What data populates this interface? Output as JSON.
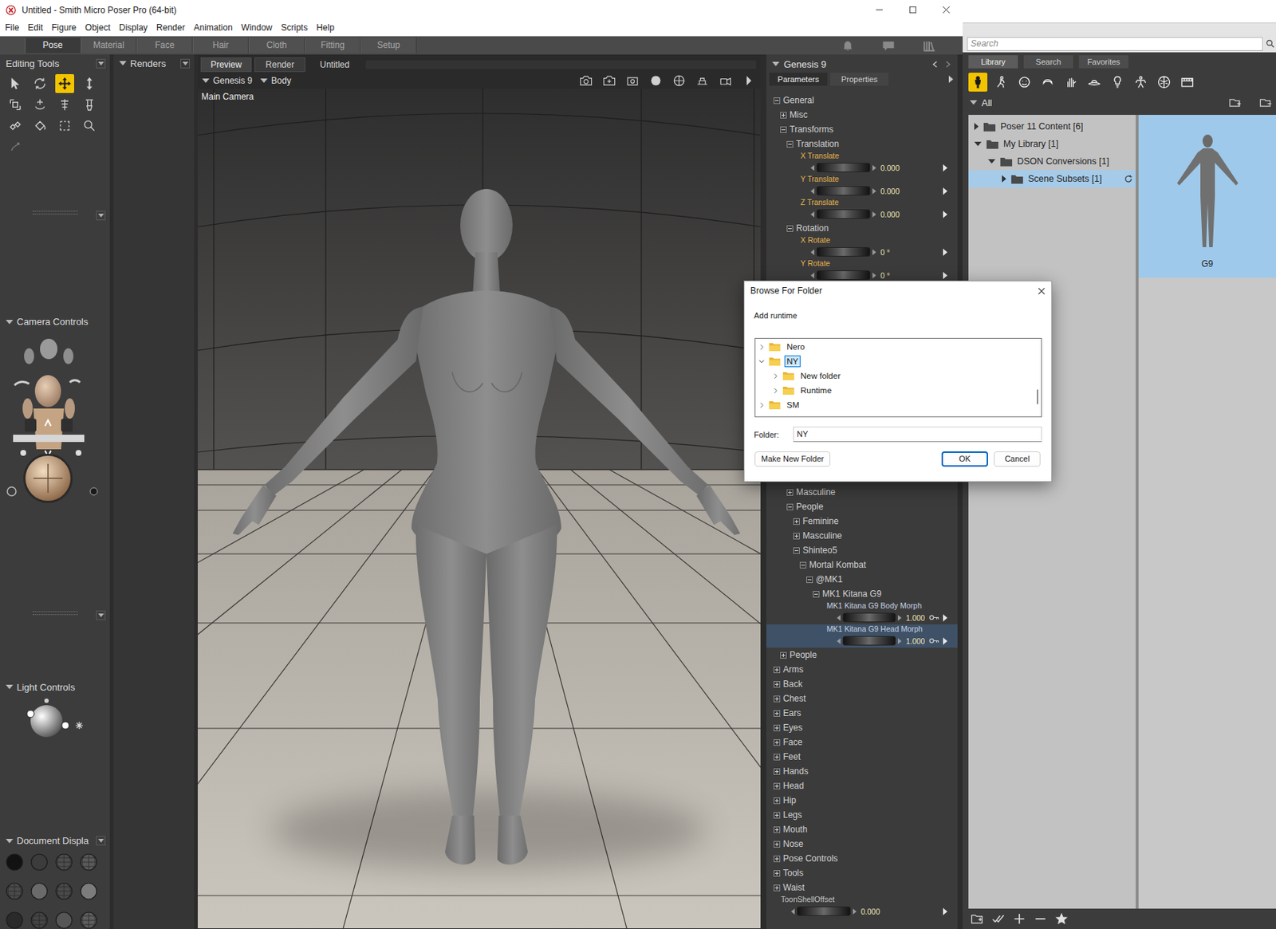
{
  "window": {
    "title": "Untitled - Smith Micro Poser Pro  (64-bit)"
  },
  "menu": [
    "File",
    "Edit",
    "Figure",
    "Object",
    "Display",
    "Render",
    "Animation",
    "Window",
    "Scripts",
    "Help"
  ],
  "rooms": [
    {
      "label": "Pose",
      "selected": true
    },
    {
      "label": "Material",
      "selected": false
    },
    {
      "label": "Face",
      "selected": false
    },
    {
      "label": "Hair",
      "selected": false
    },
    {
      "label": "Cloth",
      "selected": false
    },
    {
      "label": "Fitting",
      "selected": false
    },
    {
      "label": "Setup",
      "selected": false
    }
  ],
  "panels": {
    "editing_tools": "Editing Tools",
    "camera_controls": "Camera Controls",
    "light_controls": "Light Controls",
    "document_display": "Document Displa",
    "renders": "Renders"
  },
  "tools": [
    {
      "selected": false
    },
    {
      "selected": false
    },
    {
      "selected": true
    },
    {
      "selected": false
    },
    {
      "selected": false
    },
    {
      "selected": false
    },
    {
      "selected": false
    },
    {
      "selected": false
    },
    {
      "selected": false
    },
    {
      "selected": false
    },
    {
      "selected": false
    },
    {
      "selected": false
    },
    {
      "selected": false
    }
  ],
  "viewport": {
    "tabs": [
      {
        "label": "Preview",
        "selected": true
      },
      {
        "label": "Render",
        "selected": false
      }
    ],
    "document": "Untitled",
    "figure": "Genesis 9",
    "actor": "Body",
    "camera": "Main Camera"
  },
  "parameters": {
    "figure": "Genesis 9",
    "tabs": [
      {
        "label": "Parameters",
        "selected": true
      },
      {
        "label": "Properties",
        "selected": false
      }
    ],
    "rows_top": [
      {
        "kind": "group",
        "label": "General",
        "indent": 0,
        "expanded": true,
        "selected": false
      },
      {
        "kind": "group",
        "label": "Misc",
        "indent": 1,
        "expanded": false,
        "selected": false
      },
      {
        "kind": "group",
        "label": "Transforms",
        "indent": 1,
        "expanded": true,
        "selected": false
      },
      {
        "kind": "group",
        "label": "Translation",
        "indent": 2,
        "expanded": true,
        "selected": false
      },
      {
        "kind": "dial",
        "label": "X Translate",
        "indent": 3,
        "value": "0.000",
        "selected": false,
        "keyed": false,
        "color": "#e6b450"
      },
      {
        "kind": "dial",
        "label": "Y Translate",
        "indent": 3,
        "value": "0.000",
        "selected": false,
        "keyed": false,
        "color": "#e6b450"
      },
      {
        "kind": "dial",
        "label": "Z Translate",
        "indent": 3,
        "value": "0.000",
        "selected": false,
        "keyed": false,
        "color": "#e6b450"
      },
      {
        "kind": "group",
        "label": "Rotation",
        "indent": 2,
        "expanded": true,
        "selected": false
      },
      {
        "kind": "dial",
        "label": "X Rotate",
        "indent": 3,
        "value": "0 °",
        "selected": false,
        "keyed": false,
        "color": "#e6b450"
      },
      {
        "kind": "dial",
        "label": "Y Rotate",
        "indent": 3,
        "value": "0 °",
        "selected": false,
        "keyed": false,
        "color": "#e6b450"
      }
    ],
    "rows_bottom": [
      {
        "kind": "group",
        "label": "Masculine",
        "indent": 2,
        "expanded": false,
        "selected": false
      },
      {
        "kind": "group",
        "label": "People",
        "indent": 2,
        "expanded": true,
        "selected": false
      },
      {
        "kind": "group",
        "label": "Feminine",
        "indent": 3,
        "expanded": false,
        "selected": false
      },
      {
        "kind": "group",
        "label": "Masculine",
        "indent": 3,
        "expanded": false,
        "selected": false
      },
      {
        "kind": "group",
        "label": "Shinteo5",
        "indent": 3,
        "expanded": true,
        "selected": false
      },
      {
        "kind": "group",
        "label": "Mortal Kombat",
        "indent": 4,
        "expanded": true,
        "selected": false
      },
      {
        "kind": "group",
        "label": "@MK1",
        "indent": 5,
        "expanded": true,
        "selected": false
      },
      {
        "kind": "group",
        "label": "MK1 Kitana G9",
        "indent": 6,
        "expanded": true,
        "selected": false
      },
      {
        "kind": "dial",
        "label": "MK1 Kitana G9 Body Morph",
        "indent": 7,
        "value": "1.000",
        "selected": false,
        "keyed": true,
        "color": "#c6d4e4"
      },
      {
        "kind": "dial",
        "label": "MK1 Kitana G9 Head Morph",
        "indent": 7,
        "value": "1.000",
        "selected": true,
        "keyed": true,
        "color": "#c6d4e4"
      },
      {
        "kind": "group",
        "label": "People",
        "indent": 1,
        "expanded": false,
        "selected": false
      },
      {
        "kind": "group",
        "label": "Arms",
        "indent": 0,
        "expanded": false,
        "selected": false
      },
      {
        "kind": "group",
        "label": "Back",
        "indent": 0,
        "expanded": false,
        "selected": false
      },
      {
        "kind": "group",
        "label": "Chest",
        "indent": 0,
        "expanded": false,
        "selected": false
      },
      {
        "kind": "group",
        "label": "Ears",
        "indent": 0,
        "expanded": false,
        "selected": false
      },
      {
        "kind": "group",
        "label": "Eyes",
        "indent": 0,
        "expanded": false,
        "selected": false
      },
      {
        "kind": "group",
        "label": "Face",
        "indent": 0,
        "expanded": false,
        "selected": false
      },
      {
        "kind": "group",
        "label": "Feet",
        "indent": 0,
        "expanded": false,
        "selected": false
      },
      {
        "kind": "group",
        "label": "Hands",
        "indent": 0,
        "expanded": false,
        "selected": false
      },
      {
        "kind": "group",
        "label": "Head",
        "indent": 0,
        "expanded": false,
        "selected": false
      },
      {
        "kind": "group",
        "label": "Hip",
        "indent": 0,
        "expanded": false,
        "selected": false
      },
      {
        "kind": "group",
        "label": "Legs",
        "indent": 0,
        "expanded": false,
        "selected": false
      },
      {
        "kind": "group",
        "label": "Mouth",
        "indent": 0,
        "expanded": false,
        "selected": false
      },
      {
        "kind": "group",
        "label": "Nose",
        "indent": 0,
        "expanded": false,
        "selected": false
      },
      {
        "kind": "group",
        "label": "Pose Controls",
        "indent": 0,
        "expanded": false,
        "selected": false
      },
      {
        "kind": "group",
        "label": "Tools",
        "indent": 0,
        "expanded": false,
        "selected": false
      },
      {
        "kind": "group",
        "label": "Waist",
        "indent": 0,
        "expanded": false,
        "selected": false
      },
      {
        "kind": "dial",
        "label": "ToonShellOffset",
        "indent": 0,
        "value": "0.000",
        "selected": false,
        "keyed": false,
        "color": "#c4c4c4"
      }
    ]
  },
  "library": {
    "search_placeholder": "Search",
    "tabs": [
      {
        "label": "Library",
        "selected": true
      },
      {
        "label": "Search",
        "selected": false
      },
      {
        "label": "Favorites",
        "selected": false
      }
    ],
    "categories": [
      {
        "selected": true
      },
      {
        "selected": false
      },
      {
        "selected": false
      },
      {
        "selected": false
      },
      {
        "selected": false
      },
      {
        "selected": false
      },
      {
        "selected": false
      },
      {
        "selected": false
      },
      {
        "selected": false
      },
      {
        "selected": false
      }
    ],
    "filter": "All",
    "tree": [
      {
        "label": "Poser 11 Content [6]",
        "indent": 0,
        "expanded": false,
        "selected": false
      },
      {
        "label": "My Library [1]",
        "indent": 0,
        "expanded": true,
        "selected": false
      },
      {
        "label": "DSON Conversions [1]",
        "indent": 1,
        "expanded": true,
        "selected": false
      },
      {
        "label": "Scene Subsets [1]",
        "indent": 2,
        "expanded": false,
        "selected": true
      }
    ],
    "items": [
      {
        "label": "G9",
        "selected": true
      }
    ]
  },
  "dialog": {
    "title": "Browse For Folder",
    "prompt": "Add runtime",
    "tree": [
      {
        "label": "Nero",
        "indent": 0,
        "expanded": false,
        "selected": false
      },
      {
        "label": "NY",
        "indent": 0,
        "expanded": true,
        "selected": true
      },
      {
        "label": "New folder",
        "indent": 1,
        "expanded": false,
        "selected": false
      },
      {
        "label": "Runtime",
        "indent": 1,
        "expanded": false,
        "selected": false
      },
      {
        "label": "SM",
        "indent": 0,
        "expanded": false,
        "selected": false
      }
    ],
    "folder_label": "Folder:",
    "folder_value": "NY",
    "buttons": [
      {
        "label": "Make New Folder",
        "default": false
      },
      {
        "label": "OK",
        "default": true
      },
      {
        "label": "Cancel",
        "default": false
      }
    ]
  }
}
